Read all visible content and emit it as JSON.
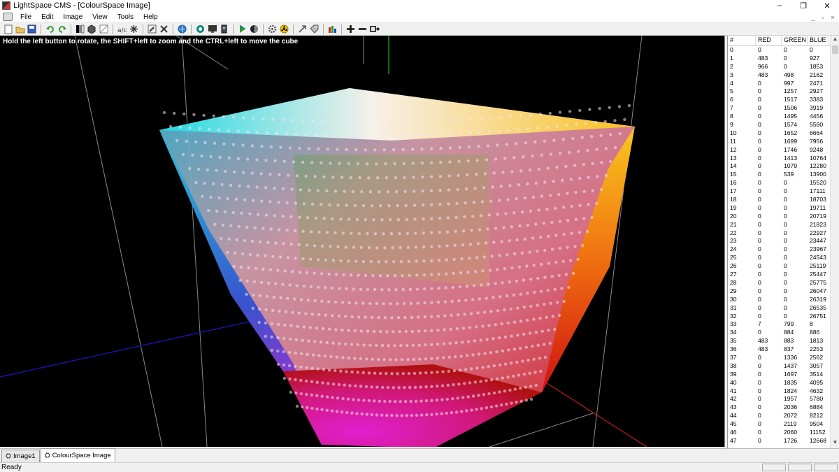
{
  "window": {
    "title": "LightSpace CMS - [ColourSpace Image]"
  },
  "window_controls": {
    "minimize": "–",
    "restore": "❐",
    "close": "✕"
  },
  "mdi_controls": {
    "minimize": "_",
    "restore": "▫",
    "close": "×"
  },
  "menu": [
    "File",
    "Edit",
    "Image",
    "View",
    "Tools",
    "Help"
  ],
  "toolbar_icons": [
    "new-icon",
    "open-icon",
    "save-icon",
    "undo-icon",
    "redo-icon",
    "channels-icon",
    "cube-icon",
    "blank-icon",
    "measure-icon",
    "snowflake-icon",
    "edit-icon",
    "tools-icon",
    "globe-icon",
    "target-icon",
    "display-icon",
    "probe-icon",
    "play-icon",
    "contrast-icon",
    "gear-icon",
    "radiation-icon",
    "arrow-icon",
    "tag-icon",
    "histogram-icon",
    "zoom-in-icon",
    "zoom-out-icon",
    "fit-icon"
  ],
  "viewport": {
    "instruction": "Hold the left button to rotate, the SHIFT+left to zoom and the CTRL+left to move the cube"
  },
  "table": {
    "headers": {
      "index": "#",
      "red": "RED",
      "green": "GREEN",
      "blue": "BLUE"
    },
    "rows": [
      [
        "0",
        "0",
        "0",
        "0"
      ],
      [
        "1",
        "483",
        "0",
        "927"
      ],
      [
        "2",
        "966",
        "0",
        "1853"
      ],
      [
        "3",
        "483",
        "498",
        "2162"
      ],
      [
        "4",
        "0",
        "997",
        "2471"
      ],
      [
        "5",
        "0",
        "1257",
        "2927"
      ],
      [
        "6",
        "0",
        "1517",
        "3383"
      ],
      [
        "7",
        "0",
        "1506",
        "3919"
      ],
      [
        "8",
        "0",
        "1495",
        "4456"
      ],
      [
        "9",
        "0",
        "1574",
        "5560"
      ],
      [
        "10",
        "0",
        "1652",
        "6664"
      ],
      [
        "11",
        "0",
        "1699",
        "7956"
      ],
      [
        "12",
        "0",
        "1746",
        "9248"
      ],
      [
        "13",
        "0",
        "1413",
        "10764"
      ],
      [
        "14",
        "0",
        "1079",
        "12280"
      ],
      [
        "15",
        "0",
        "539",
        "13900"
      ],
      [
        "16",
        "0",
        "0",
        "15520"
      ],
      [
        "17",
        "0",
        "0",
        "17111"
      ],
      [
        "18",
        "0",
        "0",
        "18703"
      ],
      [
        "19",
        "0",
        "0",
        "19711"
      ],
      [
        "20",
        "0",
        "0",
        "20719"
      ],
      [
        "21",
        "0",
        "0",
        "21823"
      ],
      [
        "22",
        "0",
        "0",
        "22927"
      ],
      [
        "23",
        "0",
        "0",
        "23447"
      ],
      [
        "24",
        "0",
        "0",
        "23967"
      ],
      [
        "25",
        "0",
        "0",
        "24543"
      ],
      [
        "26",
        "0",
        "0",
        "25119"
      ],
      [
        "27",
        "0",
        "0",
        "25447"
      ],
      [
        "28",
        "0",
        "0",
        "25775"
      ],
      [
        "29",
        "0",
        "0",
        "26047"
      ],
      [
        "30",
        "0",
        "0",
        "26319"
      ],
      [
        "31",
        "0",
        "0",
        "26535"
      ],
      [
        "32",
        "0",
        "0",
        "26751"
      ],
      [
        "33",
        "7",
        "799",
        "8"
      ],
      [
        "34",
        "0",
        "884",
        "886"
      ],
      [
        "35",
        "483",
        "883",
        "1813"
      ],
      [
        "36",
        "483",
        "837",
        "2253"
      ],
      [
        "37",
        "0",
        "1336",
        "2562"
      ],
      [
        "38",
        "0",
        "1437",
        "3057"
      ],
      [
        "39",
        "0",
        "1697",
        "3514"
      ],
      [
        "40",
        "0",
        "1835",
        "4095"
      ],
      [
        "41",
        "0",
        "1824",
        "4632"
      ],
      [
        "42",
        "0",
        "1957",
        "5780"
      ],
      [
        "43",
        "0",
        "2036",
        "6884"
      ],
      [
        "44",
        "0",
        "2072",
        "8212"
      ],
      [
        "45",
        "0",
        "2119",
        "9504"
      ],
      [
        "46",
        "0",
        "2060",
        "11152"
      ],
      [
        "47",
        "0",
        "1726",
        "12668"
      ]
    ]
  },
  "scroll": {
    "up": "▲",
    "down": "▼"
  },
  "tabs": [
    {
      "label": "Image1",
      "icon": "image-tab-icon"
    },
    {
      "label": "ColourSpace Image",
      "icon": "colourspace-tab-icon",
      "active": true
    }
  ],
  "tab_icon_glyph": "⛭",
  "status": {
    "text": "Ready"
  },
  "colors": {
    "viewport_bg": "#000000",
    "axis_green": "#18c018",
    "axis_blue": "#1818c8",
    "axis_red": "#c81818",
    "frame": "#8a8a8a"
  }
}
